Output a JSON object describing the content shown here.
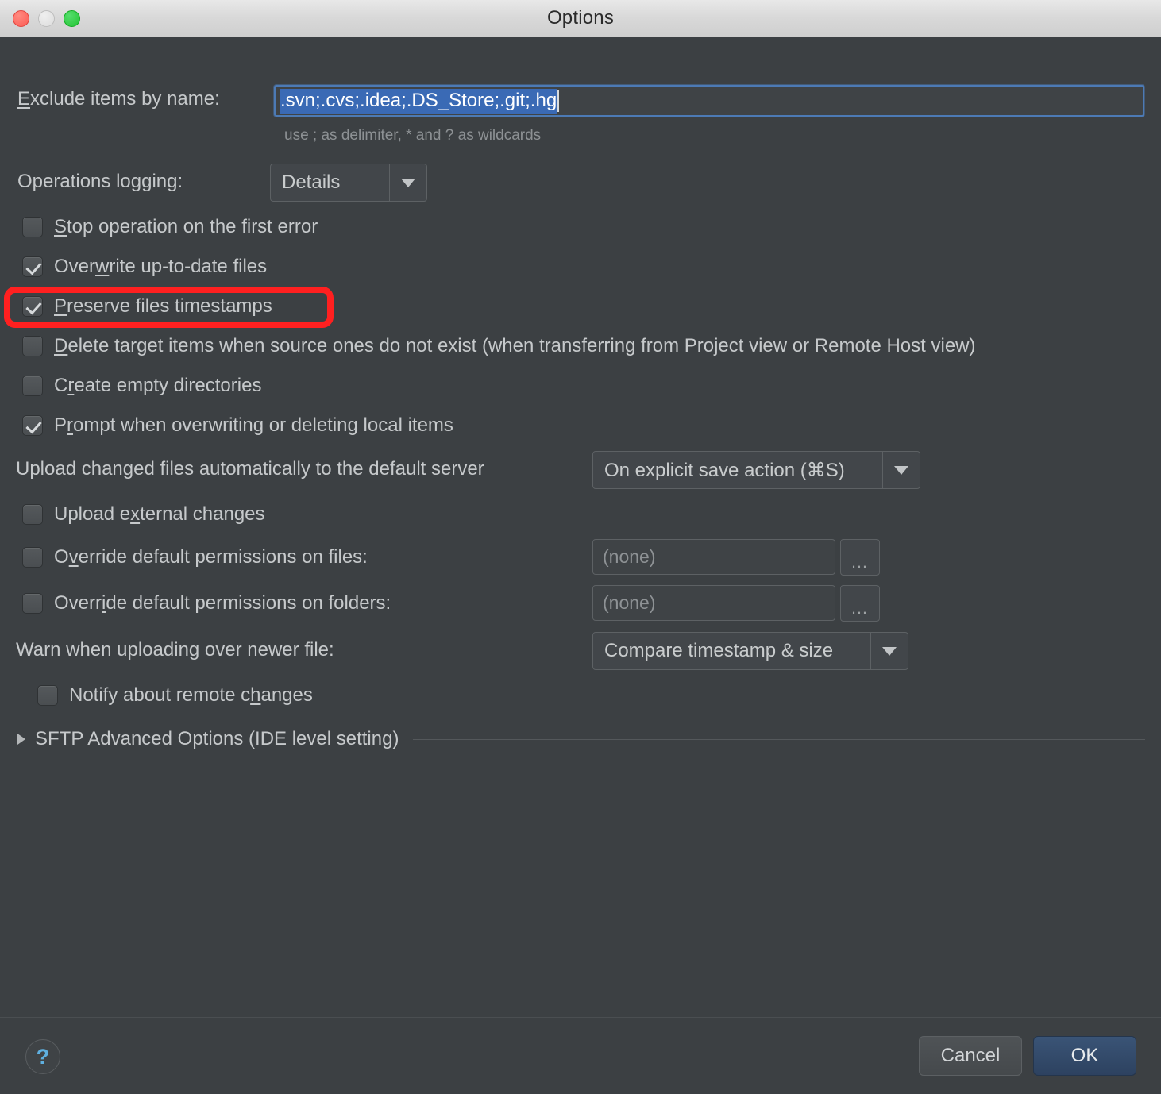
{
  "window": {
    "title": "Options",
    "traffic_lights": [
      "close-button",
      "minimize-button",
      "maximize-button"
    ],
    "colors": {
      "background": "#3c4043",
      "accent_selection": "#3a6ab5",
      "annotation_red": "#ff2020",
      "ok_button_blue": "#35506e",
      "help_blue": "#5fb0e0"
    }
  },
  "exclude": {
    "label_prefix": "E",
    "label_rest": "xclude items by name:",
    "value": ".svn;.cvs;.idea;.DS_Store;.git;.hg",
    "hint": "use ; as delimiter, * and ? as wildcards"
  },
  "operations_logging": {
    "label": "Operations logging:",
    "value": "Details"
  },
  "checkboxes": [
    {
      "name": "stop-operation-on-first-error",
      "mn": "S",
      "rest": "top operation on the first error",
      "checked": false
    },
    {
      "name": "overwrite-up-to-date-files",
      "pre": "Over",
      "mn": "w",
      "rest": "rite up-to-date files",
      "checked": true
    },
    {
      "name": "preserve-files-timestamps",
      "mn": "P",
      "rest": "reserve files timestamps",
      "checked": true,
      "highlighted": true
    },
    {
      "name": "delete-target-items",
      "mn": "D",
      "rest": "elete target items when source ones do not exist (when transferring from Project view or Remote Host view)",
      "checked": false
    },
    {
      "name": "create-empty-directories",
      "pre": "C",
      "mn": "r",
      "rest": "eate empty directories",
      "checked": false
    },
    {
      "name": "prompt-when-overwriting",
      "pre": "P",
      "mn": "r",
      "rest": "ompt when overwriting or deleting local items",
      "checked": true
    },
    {
      "name": "upload-external-changes",
      "pre": "Upload e",
      "mn": "x",
      "rest": "ternal changes",
      "checked": false
    },
    {
      "name": "override-permissions-files",
      "pre": "O",
      "mn": "v",
      "rest": "erride default permissions on files:",
      "checked": false
    },
    {
      "name": "override-permissions-folders",
      "pre": "Overr",
      "mn": "i",
      "rest": "de default permissions on folders:",
      "checked": false
    },
    {
      "name": "notify-about-remote-changes",
      "pre": "Notify about remote c",
      "mn": "h",
      "rest": "anges",
      "checked": false
    }
  ],
  "upload_auto": {
    "label": "Upload changed files automatically to the default server",
    "value": "On explicit save action (⌘S)"
  },
  "permissions": {
    "files_value": "(none)",
    "folders_value": "(none)",
    "browse_label": "…"
  },
  "warn_upload": {
    "label": "Warn when uploading over newer file:",
    "value": "Compare timestamp & size"
  },
  "sftp_section": {
    "label": "SFTP Advanced Options (IDE level setting)",
    "expanded": false,
    "arrow": "collapsed-triangle-icon"
  },
  "footer": {
    "help_label": "?",
    "cancel_label": "Cancel",
    "ok_label": "OK"
  }
}
